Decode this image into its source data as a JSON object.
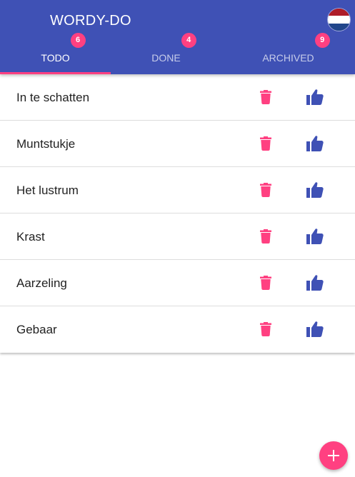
{
  "app": {
    "title": "WORDY-DO",
    "language_flag": "netherlands-flag",
    "colors": {
      "primary": "#3f51b5",
      "accent": "#ff4081"
    }
  },
  "tabs": [
    {
      "label": "TODO",
      "count": "6",
      "active": true
    },
    {
      "label": "DONE",
      "count": "4",
      "active": false
    },
    {
      "label": "ARCHIVED",
      "count": "9",
      "active": false
    }
  ],
  "words": [
    {
      "text": "In te schatten"
    },
    {
      "text": "Muntstukje"
    },
    {
      "text": "Het lustrum"
    },
    {
      "text": "Krast"
    },
    {
      "text": "Aarzeling"
    },
    {
      "text": "Gebaar"
    }
  ],
  "actions": {
    "delete_icon": "trash-icon",
    "done_icon": "thumbs-up-icon",
    "add_icon": "plus-icon"
  }
}
